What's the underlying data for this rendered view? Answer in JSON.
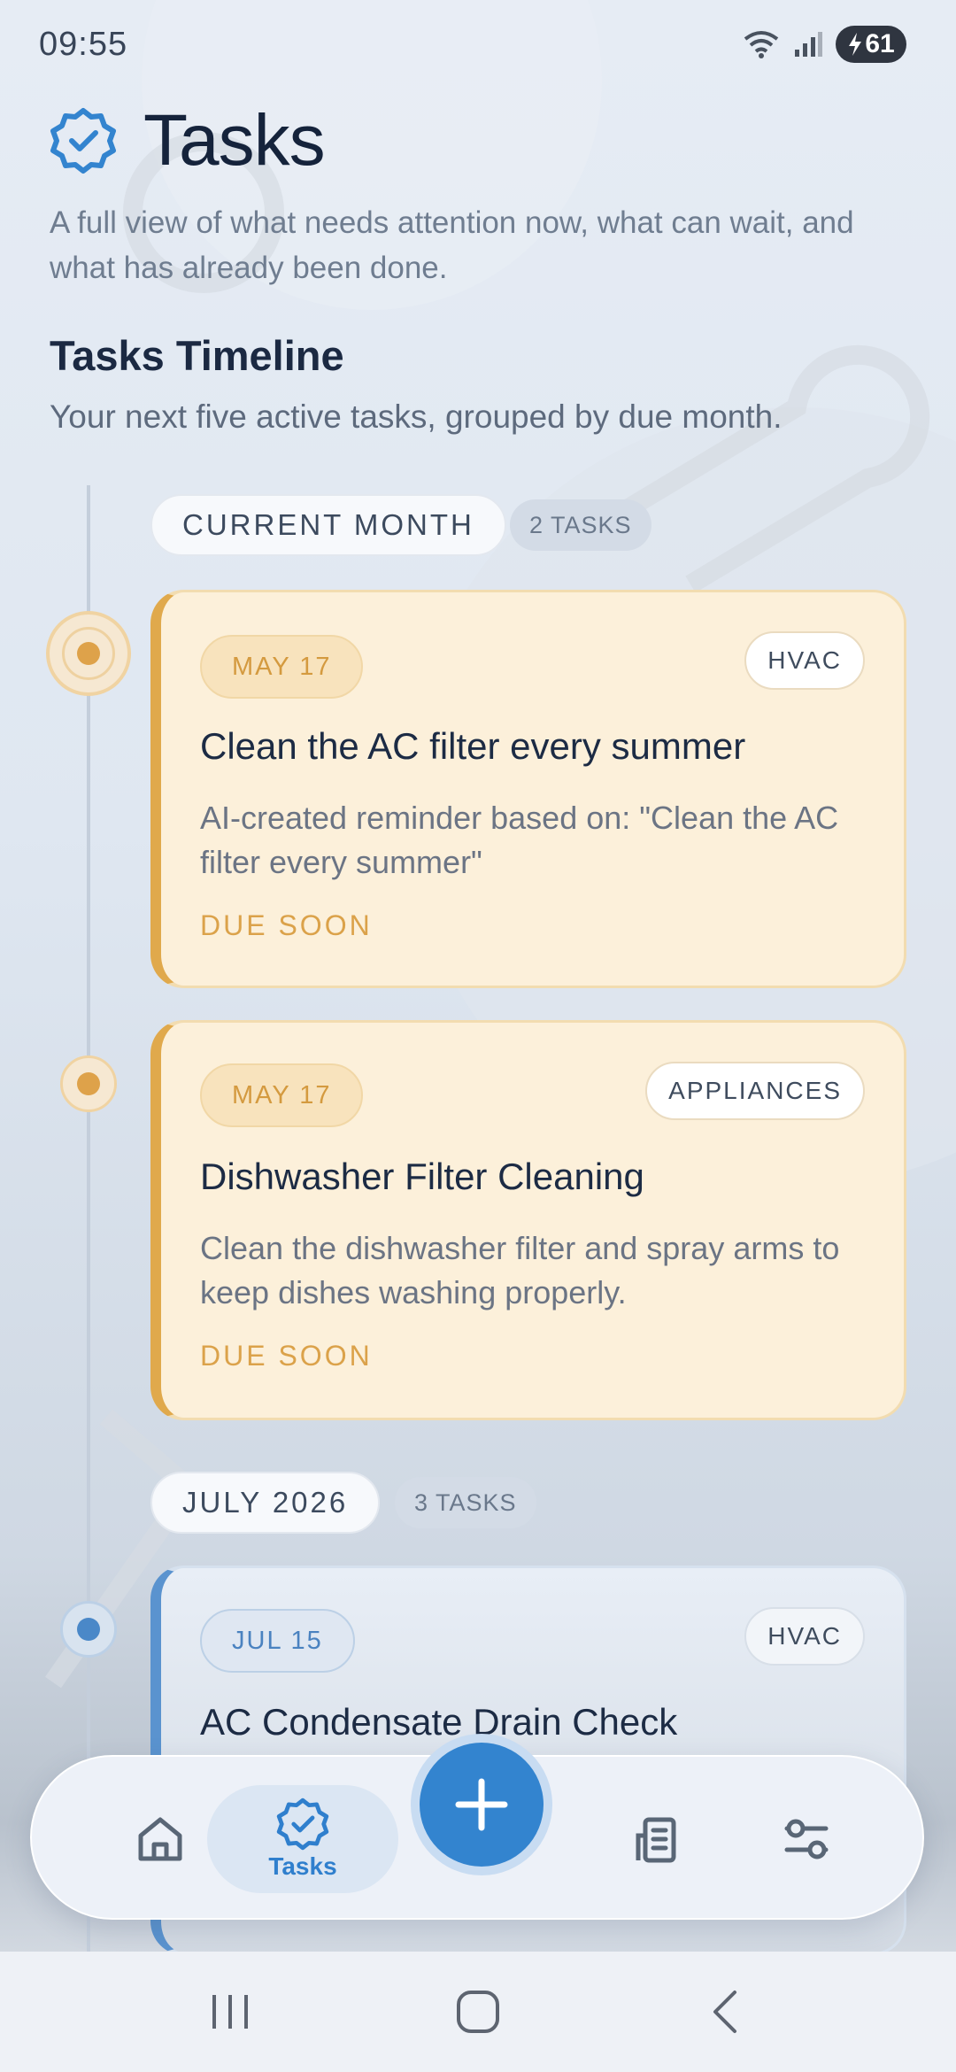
{
  "status_bar": {
    "time": "09:55",
    "battery_level": "61"
  },
  "header": {
    "title": "Tasks",
    "subtitle": "A full view of what needs attention now, what can wait, and what has already been done."
  },
  "timeline": {
    "title": "Tasks Timeline",
    "subtitle": "Your next five active tasks, grouped by due month.",
    "groups": [
      {
        "label": "CURRENT MONTH",
        "count": "2 TASKS",
        "tasks": [
          {
            "date": "MAY 17",
            "category": "HVAC",
            "title": "Clean the AC filter every summer",
            "description": "AI-created reminder based on: \"Clean the AC filter every summer\"",
            "status": "DUE SOON"
          },
          {
            "date": "MAY 17",
            "category": "APPLIANCES",
            "title": "Dishwasher Filter Cleaning",
            "description": "Clean the dishwasher filter and spray arms to keep dishes washing properly.",
            "status": "DUE SOON"
          }
        ]
      },
      {
        "label": "JULY 2026",
        "count": "3 TASKS",
        "tasks": [
          {
            "date": "JUL 15",
            "category": "HVAC",
            "title": "AC Condensate Drain Check"
          }
        ]
      }
    ]
  },
  "bottom_nav": {
    "active": "Tasks",
    "tasks_label": "Tasks"
  },
  "colors": {
    "accent": "#3384cf",
    "due_soon": "#dba24a",
    "card_bg": "#fcf0da"
  }
}
